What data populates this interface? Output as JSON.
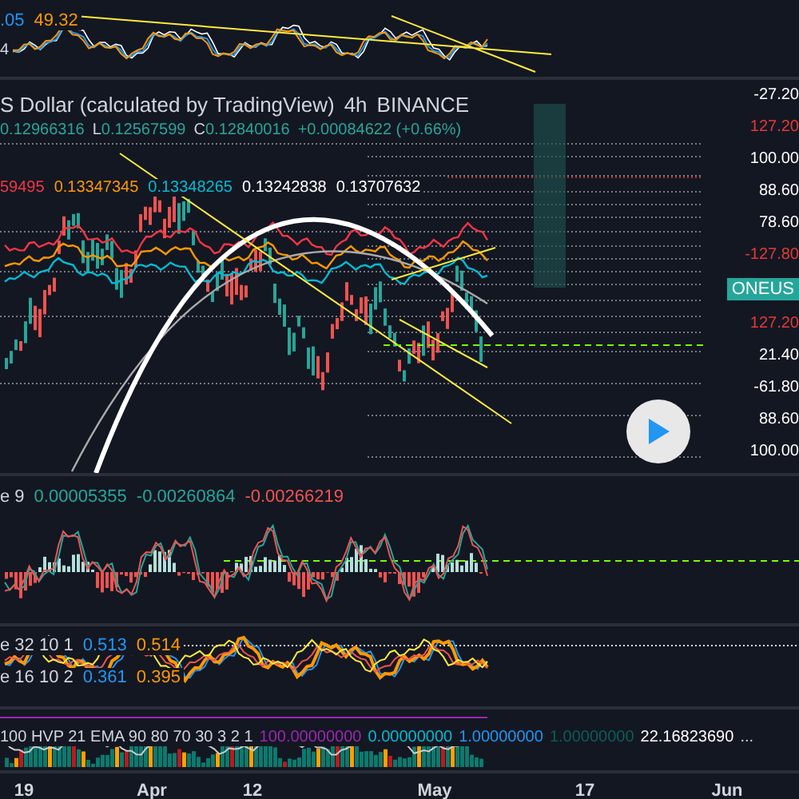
{
  "oscillator_top": {
    "legend": [
      {
        "text": ".05",
        "color": "#2196f3"
      },
      {
        "text": "49.32",
        "color": "#ff9800"
      }
    ],
    "axis_mark": "4"
  },
  "main": {
    "title": "S Dollar (calculated by TradingView)",
    "interval": "4h",
    "exchange": "BINANCE",
    "ohlc": [
      {
        "value": "0.12966316"
      },
      {
        "label": "L",
        "value": "0.12567599"
      },
      {
        "label": "C",
        "value": "0.12840016"
      },
      {
        "value": "+0.00084622 (+0.66%)"
      }
    ],
    "ma_values": [
      {
        "text": "59495",
        "color": "#f23645"
      },
      {
        "text": "0.13347345",
        "color": "#ff9800"
      },
      {
        "text": "0.13348265",
        "color": "#00bcd4"
      },
      {
        "text": "0.13242838",
        "color": "#ffffff"
      },
      {
        "text": "0.13707632",
        "color": "#ffffff"
      }
    ],
    "axis_labels": [
      {
        "text": "-27.20",
        "color": "#ffffff"
      },
      {
        "text": "127.20",
        "color": "#e53935"
      },
      {
        "text": "100.00",
        "color": "#ffffff"
      },
      {
        "text": "88.60",
        "color": "#ffffff"
      },
      {
        "text": "78.60",
        "color": "#ffffff"
      },
      {
        "text": "-127.80",
        "color": "#e53935"
      },
      {
        "text": "127.20",
        "color": "#e53935"
      },
      {
        "text": "21.40",
        "color": "#ffffff"
      },
      {
        "text": "-61.80",
        "color": "#ffffff"
      },
      {
        "text": "88.60",
        "color": "#ffffff"
      },
      {
        "text": "100.00",
        "color": "#ffffff"
      }
    ],
    "symbol_badge": "ONEUS"
  },
  "macd": {
    "label": "e 9",
    "values": [
      {
        "text": "0.00005355",
        "color": "#26a69a"
      },
      {
        "text": "-0.00260864",
        "color": "#26a69a"
      },
      {
        "text": "-0.00266219",
        "color": "#ef5350"
      }
    ]
  },
  "oscillators": [
    {
      "label": "e 32 10 1",
      "values": [
        {
          "text": "0.513",
          "color": "#2196f3"
        },
        {
          "text": "0.514",
          "color": "#ff9800"
        }
      ]
    },
    {
      "label": "e 16 10 2",
      "values": [
        {
          "text": "0.361",
          "color": "#2196f3"
        },
        {
          "text": "0.395",
          "color": "#ff9800"
        }
      ]
    }
  ],
  "volatility": {
    "label": "100 HVP 21 EMA 90 80 70 30 3 2 1",
    "values": [
      {
        "text": "100.00000000",
        "color": "#9c27b0"
      },
      {
        "text": "0.00000000",
        "color": "#00bcd4"
      },
      {
        "text": "1.00000000",
        "color": "#2196f3"
      },
      {
        "text": "1.00000000",
        "color": "#0b5e55"
      },
      {
        "text": "22.16823690",
        "color": "#ffffff"
      }
    ],
    "more": "..."
  },
  "time_axis": [
    "19",
    "Apr",
    "12",
    "May",
    "17",
    "Jun"
  ]
}
